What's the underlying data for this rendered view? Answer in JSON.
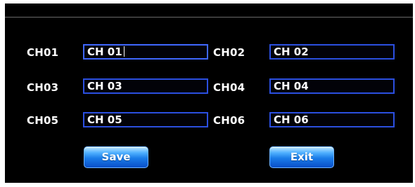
{
  "channels": [
    {
      "label": "CH01",
      "value": "CH 01"
    },
    {
      "label": "CH02",
      "value": "CH 02"
    },
    {
      "label": "CH03",
      "value": "CH 03"
    },
    {
      "label": "CH04",
      "value": "CH 04"
    },
    {
      "label": "CH05",
      "value": "CH 05"
    },
    {
      "label": "CH06",
      "value": "CH 06"
    }
  ],
  "buttons": {
    "save_label": "Save",
    "exit_label": "Exit"
  },
  "colors": {
    "background": "#000000",
    "field_border": "#2b4fe0",
    "button_blue": "#1a7ce8",
    "text": "#ffffff"
  }
}
